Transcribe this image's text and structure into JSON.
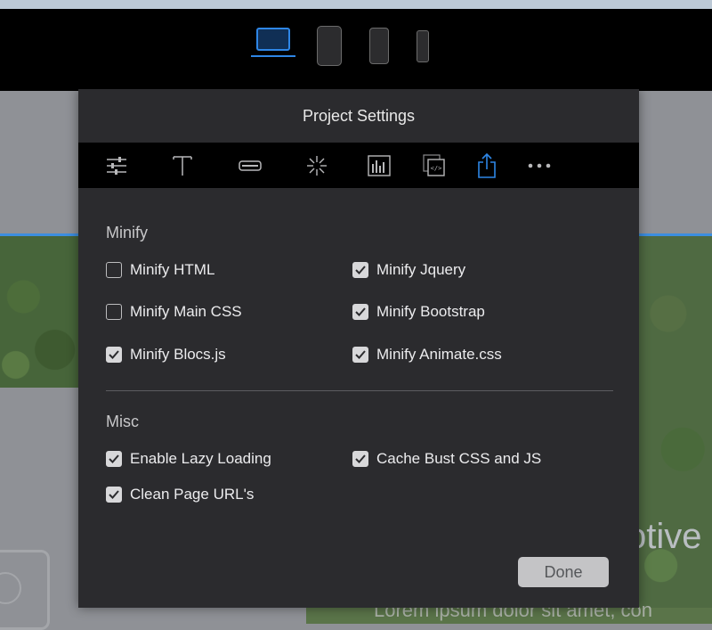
{
  "background": {
    "devices": [
      "laptop-icon",
      "tablet-icon",
      "small-tablet-icon",
      "phone-icon"
    ],
    "active_device": "laptop-icon",
    "accent": "#2e86e6",
    "partial_word": "otive",
    "partial_lorem": "Lorem ipsum dolor sit amet, con"
  },
  "dialog": {
    "title": "Project Settings",
    "toolbar": [
      {
        "icon": "sliders-icon",
        "active": false
      },
      {
        "icon": "text-icon",
        "active": false
      },
      {
        "icon": "button-icon",
        "active": false
      },
      {
        "icon": "loader-icon",
        "active": false
      },
      {
        "icon": "chart-icon",
        "active": false
      },
      {
        "icon": "code-pages-icon",
        "active": false
      },
      {
        "icon": "share-export-icon",
        "active": true
      },
      {
        "icon": "more-icon",
        "active": false
      }
    ],
    "minify": {
      "title": "Minify",
      "options": [
        {
          "label": "Minify HTML",
          "checked": false
        },
        {
          "label": "Minify Jquery",
          "checked": true
        },
        {
          "label": "Minify Main CSS",
          "checked": false
        },
        {
          "label": "Minify Bootstrap",
          "checked": true
        },
        {
          "label": "Minify Blocs.js",
          "checked": true
        },
        {
          "label": "Minify Animate.css",
          "checked": true
        }
      ]
    },
    "misc": {
      "title": "Misc",
      "options": [
        {
          "label": "Enable Lazy Loading",
          "checked": true
        },
        {
          "label": "Cache Bust CSS and JS",
          "checked": true
        },
        {
          "label": "Clean Page URL's",
          "checked": true
        }
      ]
    },
    "done_label": "Done"
  }
}
